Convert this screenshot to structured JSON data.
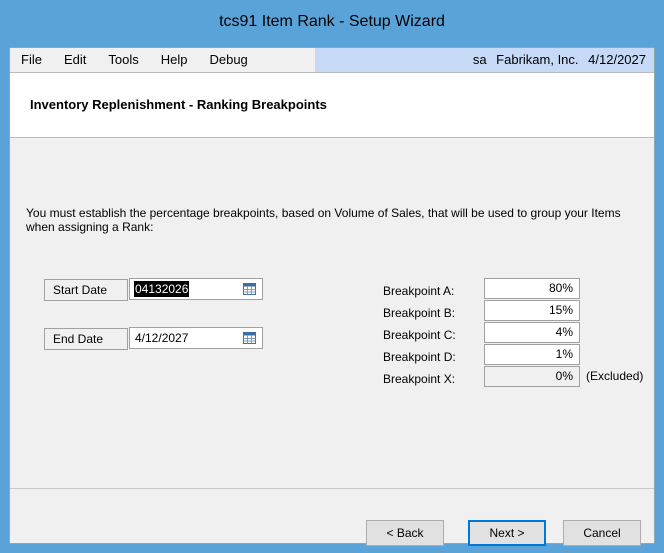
{
  "window": {
    "title": "tcs91 Item Rank - Setup Wizard"
  },
  "menu": {
    "items": [
      "File",
      "Edit",
      "Tools",
      "Help",
      "Debug"
    ],
    "user": "sa",
    "company": "Fabrikam, Inc.",
    "date": "4/12/2027"
  },
  "header": {
    "title": "Inventory Replenishment - Ranking Breakpoints"
  },
  "description": "You must establish the percentage breakpoints, based on Volume of Sales, that will be used to group your Items when assigning a Rank:",
  "dates": {
    "start_label": "Start Date",
    "start_value": "04132026",
    "end_label": "End Date",
    "end_value": "4/12/2027",
    "calendar_icon": "calendar-icon"
  },
  "breakpoints": [
    {
      "label": "Breakpoint A:",
      "value": "80%"
    },
    {
      "label": "Breakpoint B:",
      "value": "15%"
    },
    {
      "label": "Breakpoint C:",
      "value": "4%"
    },
    {
      "label": "Breakpoint D:",
      "value": "1%"
    },
    {
      "label": "Breakpoint X:",
      "value": "0%",
      "note": "(Excluded)"
    }
  ],
  "buttons": {
    "back": "< Back",
    "next": "Next >",
    "cancel": "Cancel"
  },
  "colors": {
    "title_bar": "#5aa3d9",
    "menu_info_bg": "#c6d9f7",
    "default_button_border": "#0078d7"
  }
}
